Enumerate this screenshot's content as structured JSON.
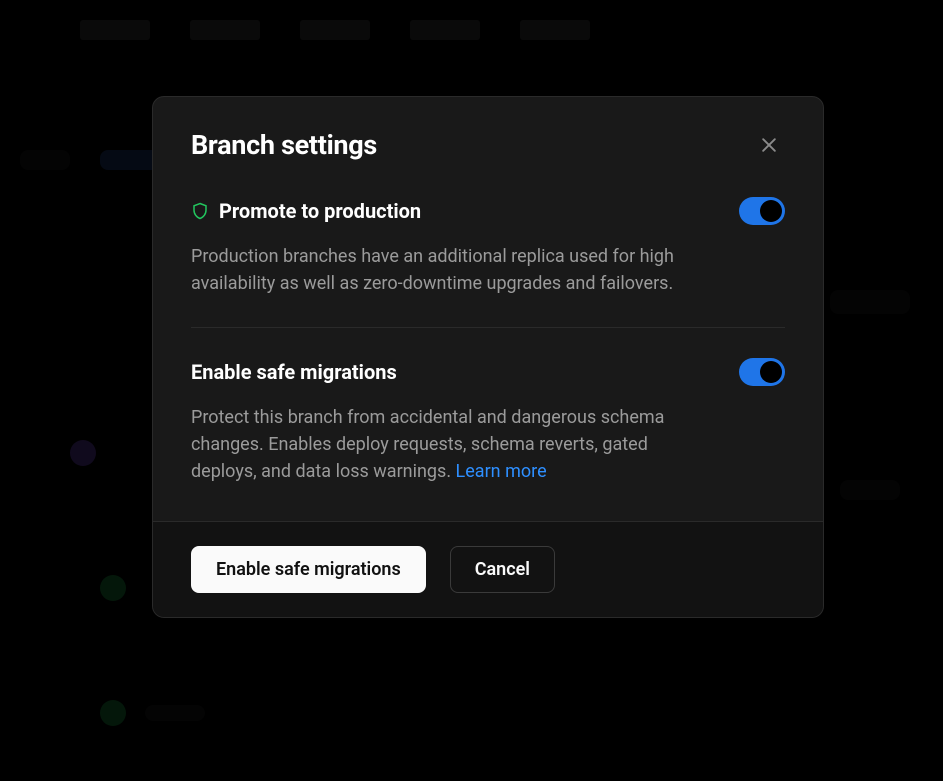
{
  "modal": {
    "title": "Branch settings",
    "sections": [
      {
        "heading": "Promote to production",
        "description": "Production branches have an additional replica used for high availability as well as zero-downtime upgrades and failovers.",
        "toggle_on": true,
        "has_shield_icon": true
      },
      {
        "heading": "Enable safe migrations",
        "description": "Protect this branch from accidental and dangerous schema changes. Enables deploy requests, schema reverts, gated deploys, and data loss warnings. ",
        "learn_more": "Learn more",
        "toggle_on": true,
        "has_shield_icon": false
      }
    ],
    "footer": {
      "primary_label": "Enable safe migrations",
      "secondary_label": "Cancel"
    }
  },
  "colors": {
    "accent_blue": "#1f75e8",
    "shield_green": "#22c55e"
  }
}
